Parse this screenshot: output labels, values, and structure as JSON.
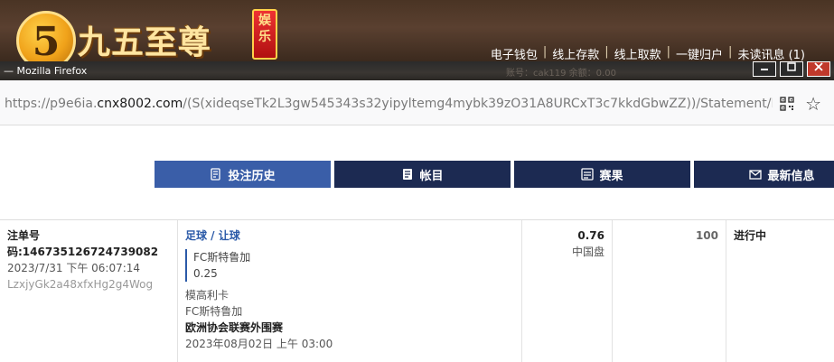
{
  "banner": {
    "logo_numeral": "5",
    "brand_name": "九五至尊",
    "brand_tag": "娱乐",
    "links": [
      "电子钱包",
      "线上存款",
      "线上取款",
      "一键归户",
      "未读讯息 (1)"
    ]
  },
  "window": {
    "title": "— Mozilla Firefox",
    "ghost_text": "账号：cak119   余额：0.00"
  },
  "urlbar": {
    "url_prefix": "https://p9e6ia.",
    "url_host": "cnx8002.com",
    "url_path": "/(S(xideqseTk2L3gw545343s32yipyltemg4mybk39zO31A8URCxT3c7kkdGbwZZ))/Statement/BetListAp"
  },
  "tabs": [
    {
      "label": "投注历史",
      "icon": "bet-history-icon",
      "active": true
    },
    {
      "label": "帐目",
      "icon": "ledger-icon",
      "active": false
    },
    {
      "label": "赛果",
      "icon": "results-icon",
      "active": false
    },
    {
      "label": "最新信息",
      "icon": "mail-icon",
      "active": false
    }
  ],
  "bet": {
    "ticket_label": "注单号码:146735126724739082",
    "datetime": "2023/7/31 下午 06:07:14",
    "token": "LzxjyGk2a48xfxHg2g4Wog",
    "sport_type": "足球 / 让球",
    "selection_team": "FC斯特鲁加",
    "handicap": "0.25",
    "home_team": "模高利卡",
    "away_team": "FC斯特鲁加",
    "league": "欧洲协会联赛外围赛",
    "event_time": "2023年08月02日 上午 03:00",
    "odds": "0.76",
    "odds_type": "中国盘",
    "stake": "100",
    "status": "进行中"
  }
}
